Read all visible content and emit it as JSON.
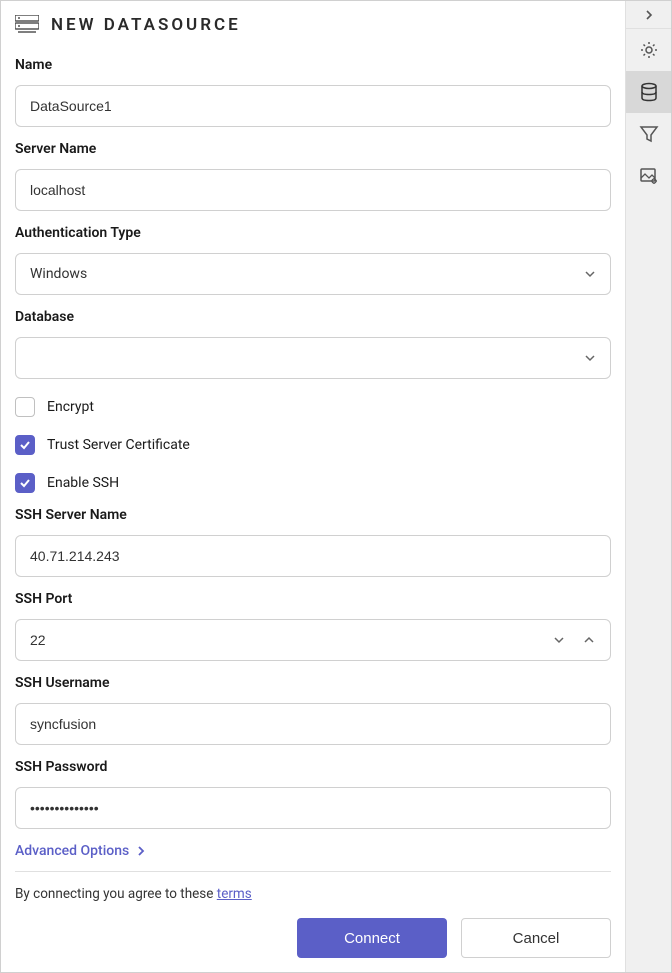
{
  "header": {
    "title": "NEW DATASOURCE"
  },
  "fields": {
    "name": {
      "label": "Name",
      "value": "DataSource1"
    },
    "serverName": {
      "label": "Server Name",
      "value": "localhost"
    },
    "authType": {
      "label": "Authentication Type",
      "value": "Windows"
    },
    "database": {
      "label": "Database",
      "value": ""
    },
    "encrypt": {
      "label": "Encrypt",
      "checked": false
    },
    "trustCert": {
      "label": "Trust Server Certificate",
      "checked": true
    },
    "enableSsh": {
      "label": "Enable SSH",
      "checked": true
    },
    "sshServerName": {
      "label": "SSH Server Name",
      "value": "40.71.214.243"
    },
    "sshPort": {
      "label": "SSH Port",
      "value": "22"
    },
    "sshUsername": {
      "label": "SSH Username",
      "value": "syncfusion"
    },
    "sshPassword": {
      "label": "SSH Password",
      "value": "••••••••••••••"
    }
  },
  "footer": {
    "advanced": "Advanced Options",
    "termsPrefix": "By connecting you agree to these ",
    "termsLink": "terms",
    "connect": "Connect",
    "cancel": "Cancel"
  }
}
